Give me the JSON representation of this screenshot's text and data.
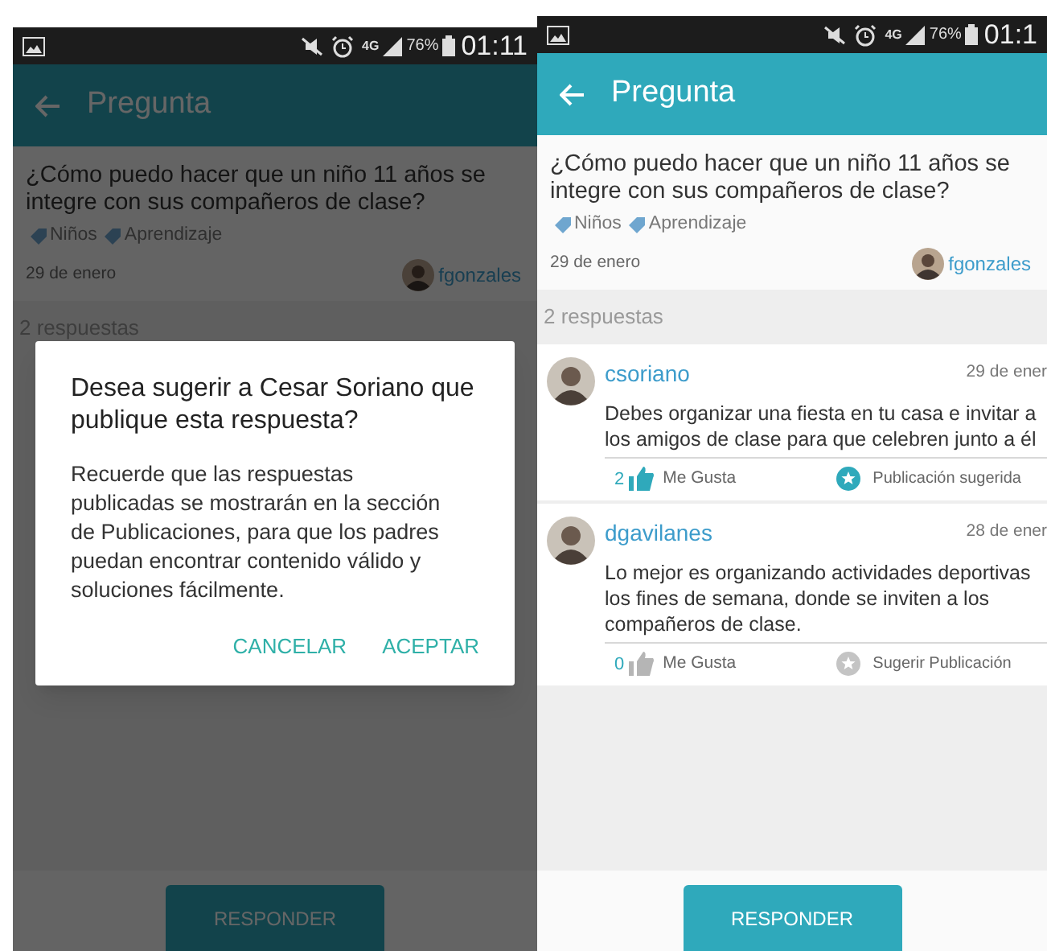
{
  "screens": [
    {
      "dimmed": true,
      "status_bar": {
        "network": "4G",
        "battery": "76%",
        "time": "01:11"
      },
      "app_bar": {
        "title": "Pregunta"
      },
      "question": {
        "text": "¿Cómo puedo hacer que un niño 11 años se\nintegre con sus compañeros de clase?",
        "tags": [
          "Niños",
          "Aprendizaje"
        ],
        "date": "29 de enero",
        "author": "fgonzales"
      },
      "answers_header": "2 respuestas",
      "dialog": {
        "title": "Desea sugerir a Cesar Soriano que\npublique esta respuesta?",
        "message": "Recuerde que las respuestas\npublicadas se mostrarán en la sección\nde Publicaciones, para que los padres\npuedan encontrar contenido válido y\nsoluciones fácilmente.",
        "buttons": [
          "CANCELAR",
          "ACEPTAR"
        ]
      },
      "reply_button": "RESPONDER"
    },
    {
      "dimmed": false,
      "status_bar": {
        "network": "4G",
        "battery": "76%",
        "time": "01:1"
      },
      "app_bar": {
        "title": "Pregunta"
      },
      "question": {
        "text": "¿Cómo puedo hacer que un niño 11 años se\nintegre con sus compañeros de clase?",
        "tags": [
          "Niños",
          "Aprendizaje"
        ],
        "date": "29 de enero",
        "author": "fgonzales"
      },
      "answers_header": "2 respuestas",
      "answers": [
        {
          "author": "csoriano",
          "date": "29 de ener",
          "text": "Debes organizar una fiesta en tu casa e invitar a\nlos amigos de clase para que celebren junto a él",
          "likes": "2",
          "liked": true,
          "like_label": "Me Gusta",
          "suggest_label": "Publicación sugerida",
          "suggested": true
        },
        {
          "author": "dgavilanes",
          "date": "28 de ener",
          "text": "Lo mejor es organizando actividades deportivas\nlos fines de semana, donde se inviten a los\ncompañeros de clase.",
          "likes": "0",
          "liked": false,
          "like_label": "Me Gusta",
          "suggest_label": "Sugerir Publicación",
          "suggested": false
        }
      ],
      "reply_button": "RESPONDER"
    }
  ]
}
